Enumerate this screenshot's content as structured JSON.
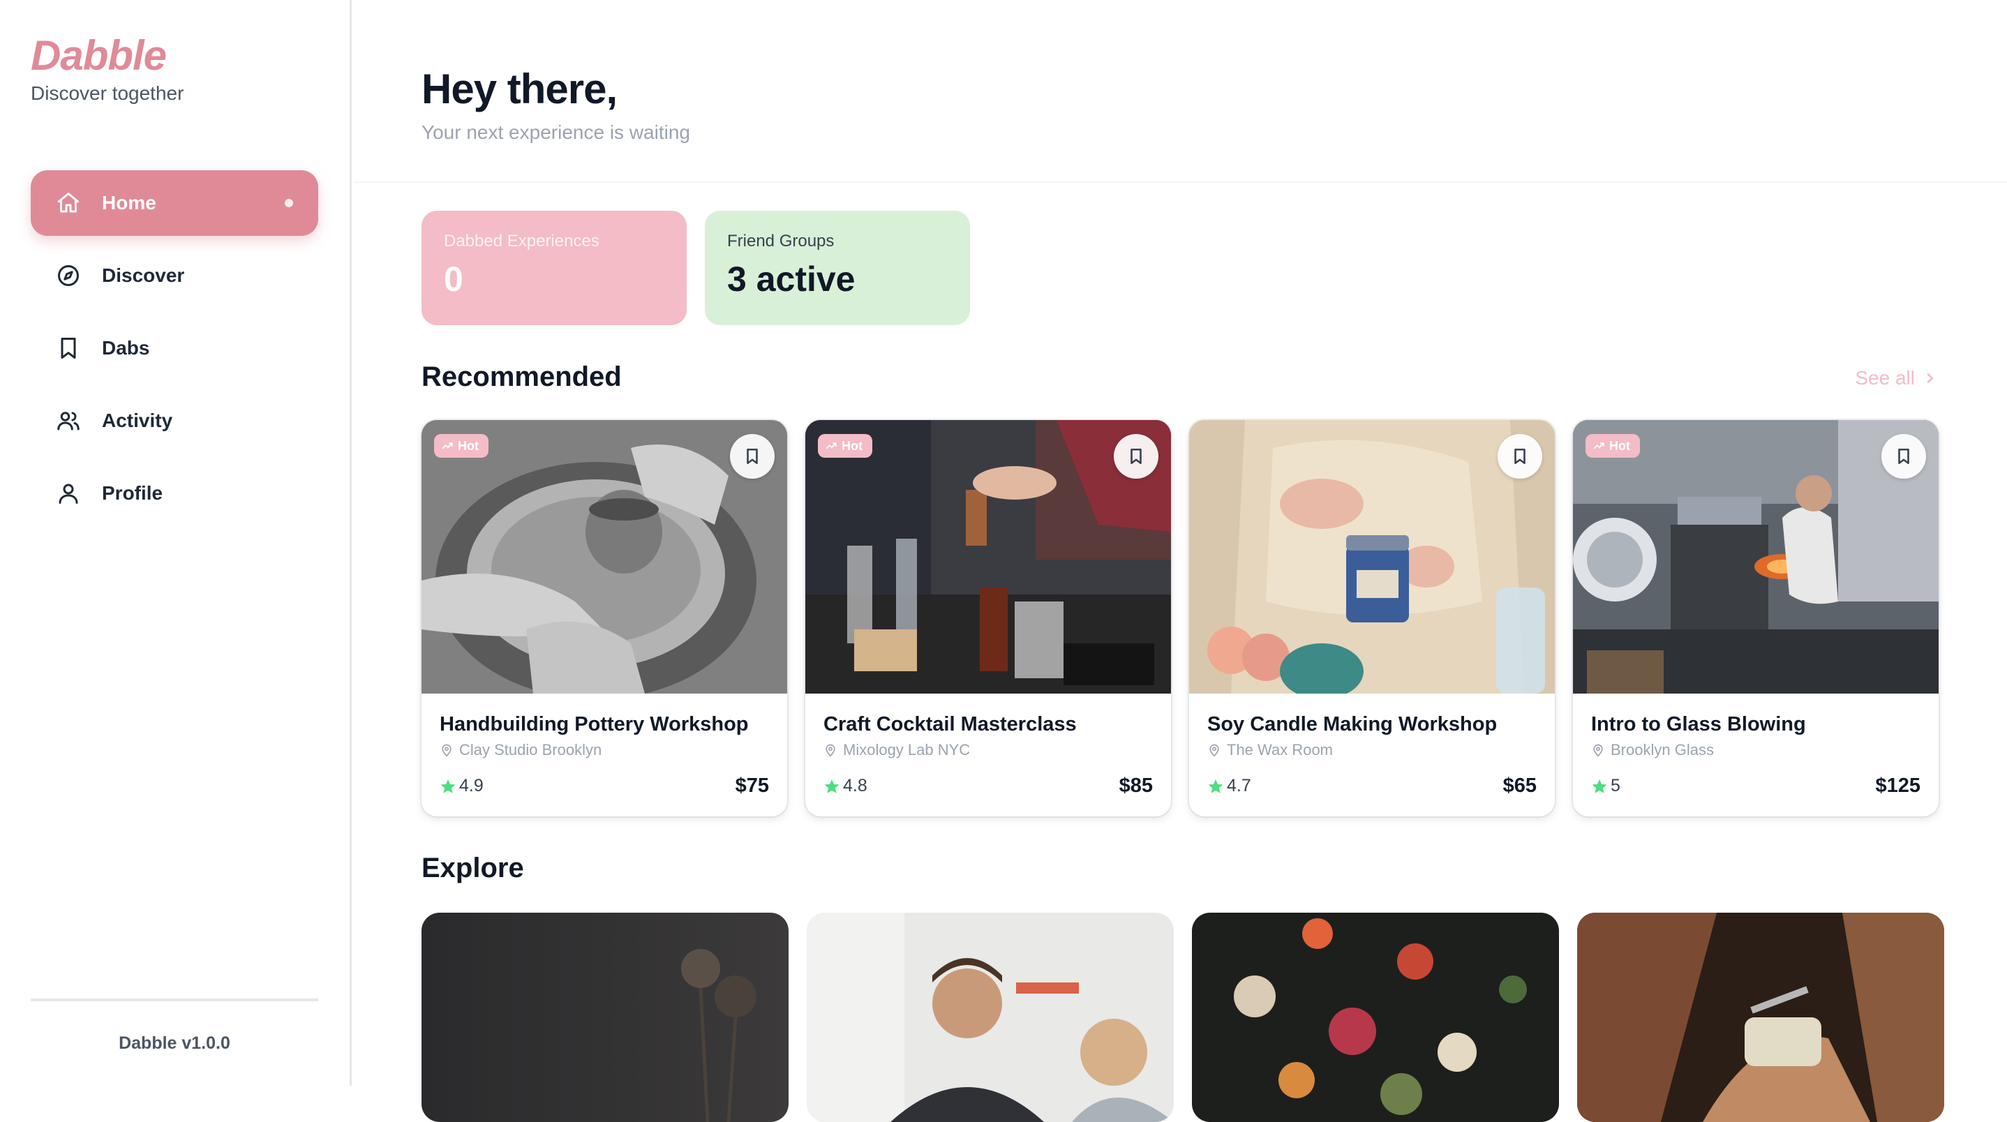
{
  "brand": {
    "name": "Dabble",
    "tagline": "Discover together"
  },
  "nav": {
    "items": [
      {
        "label": "Home",
        "icon": "home-icon",
        "active": true
      },
      {
        "label": "Discover",
        "icon": "compass-icon"
      },
      {
        "label": "Dabs",
        "icon": "bookmark-icon"
      },
      {
        "label": "Activity",
        "icon": "users-icon"
      },
      {
        "label": "Profile",
        "icon": "user-icon"
      }
    ]
  },
  "footer": {
    "version": "Dabble v1.0.0"
  },
  "header": {
    "greeting": "Hey there,",
    "subtitle": "Your next experience is waiting"
  },
  "stats": {
    "dabbed": {
      "label": "Dabbed Experiences",
      "value": "0"
    },
    "groups": {
      "label": "Friend Groups",
      "value": "3 active"
    }
  },
  "recommended": {
    "title": "Recommended",
    "see_all": "See all",
    "hot_label": "Hot",
    "cards": [
      {
        "title": "Handbuilding Pottery Workshop",
        "venue": "Clay Studio Brooklyn",
        "rating": "4.9",
        "price": "$75",
        "hot": true
      },
      {
        "title": "Craft Cocktail Masterclass",
        "venue": "Mixology Lab NYC",
        "rating": "4.8",
        "price": "$85",
        "hot": true
      },
      {
        "title": "Soy Candle Making Workshop",
        "venue": "The Wax Room",
        "rating": "4.7",
        "price": "$65",
        "hot": false
      },
      {
        "title": "Intro to Glass Blowing",
        "venue": "Brooklyn Glass",
        "rating": "5",
        "price": "$125",
        "hot": true
      }
    ]
  },
  "explore": {
    "title": "Explore"
  },
  "colors": {
    "brand_pink": "#e08a98",
    "stat_pink": "#f4bcc6",
    "stat_green": "#d8f0d8",
    "star_green": "#4ade80"
  }
}
